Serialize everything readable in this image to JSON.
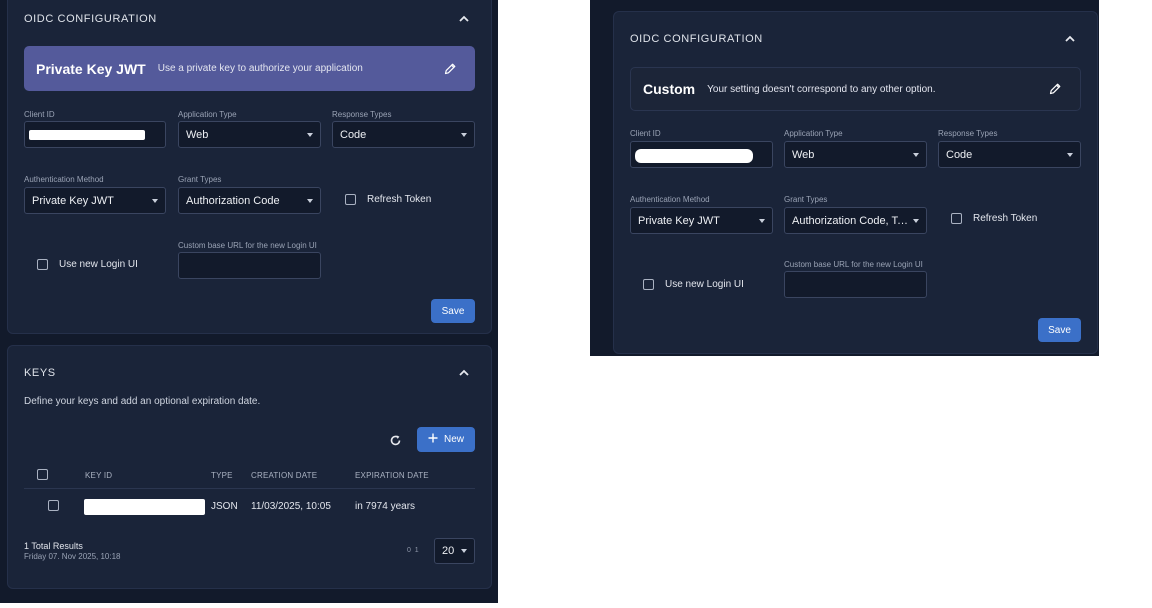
{
  "left": {
    "oidc": {
      "title": "OIDC CONFIGURATION",
      "banner": {
        "title": "Private Key JWT",
        "subtitle": "Use a private key to authorize your application",
        "color": "#545a9b"
      },
      "client_id_label": "Client ID",
      "app_type": {
        "label": "Application Type",
        "value": "Web"
      },
      "response_types": {
        "label": "Response Types",
        "value": "Code"
      },
      "auth_method": {
        "label": "Authentication Method",
        "value": "Private Key JWT"
      },
      "grant_types": {
        "label": "Grant Types",
        "value": "Authorization Code"
      },
      "refresh_token_label": "Refresh Token",
      "new_login_label": "Use new Login UI",
      "custom_url_label": "Custom base URL for the new Login UI",
      "save_label": "Save"
    },
    "keys": {
      "title": "KEYS",
      "description": "Define your keys and add an optional expiration date.",
      "new_label": "New",
      "columns": [
        "KEY ID",
        "TYPE",
        "CREATION DATE",
        "EXPIRATION DATE"
      ],
      "rows": [
        {
          "type": "JSON",
          "created": "11/03/2025, 10:05",
          "expires": "in 7974 years"
        }
      ],
      "total": "1 Total Results",
      "timestamp": "Friday 07. Nov 2025, 10:18",
      "pager": "0  1",
      "page_size": "20"
    }
  },
  "right": {
    "oidc": {
      "title": "OIDC CONFIGURATION",
      "banner": {
        "title": "Custom",
        "subtitle": "Your setting doesn't correspond to any other option.",
        "color": "#1c2538"
      },
      "client_id_label": "Client ID",
      "app_type": {
        "label": "Application Type",
        "value": "Web"
      },
      "response_types": {
        "label": "Response Types",
        "value": "Code"
      },
      "auth_method": {
        "label": "Authentication Method",
        "value": "Private Key JWT"
      },
      "grant_types": {
        "label": "Grant Types",
        "value": "Authorization Code, To..."
      },
      "refresh_token_label": "Refresh Token",
      "new_login_label": "Use new Login UI",
      "custom_url_label": "Custom base URL for the new Login UI",
      "save_label": "Save"
    }
  }
}
